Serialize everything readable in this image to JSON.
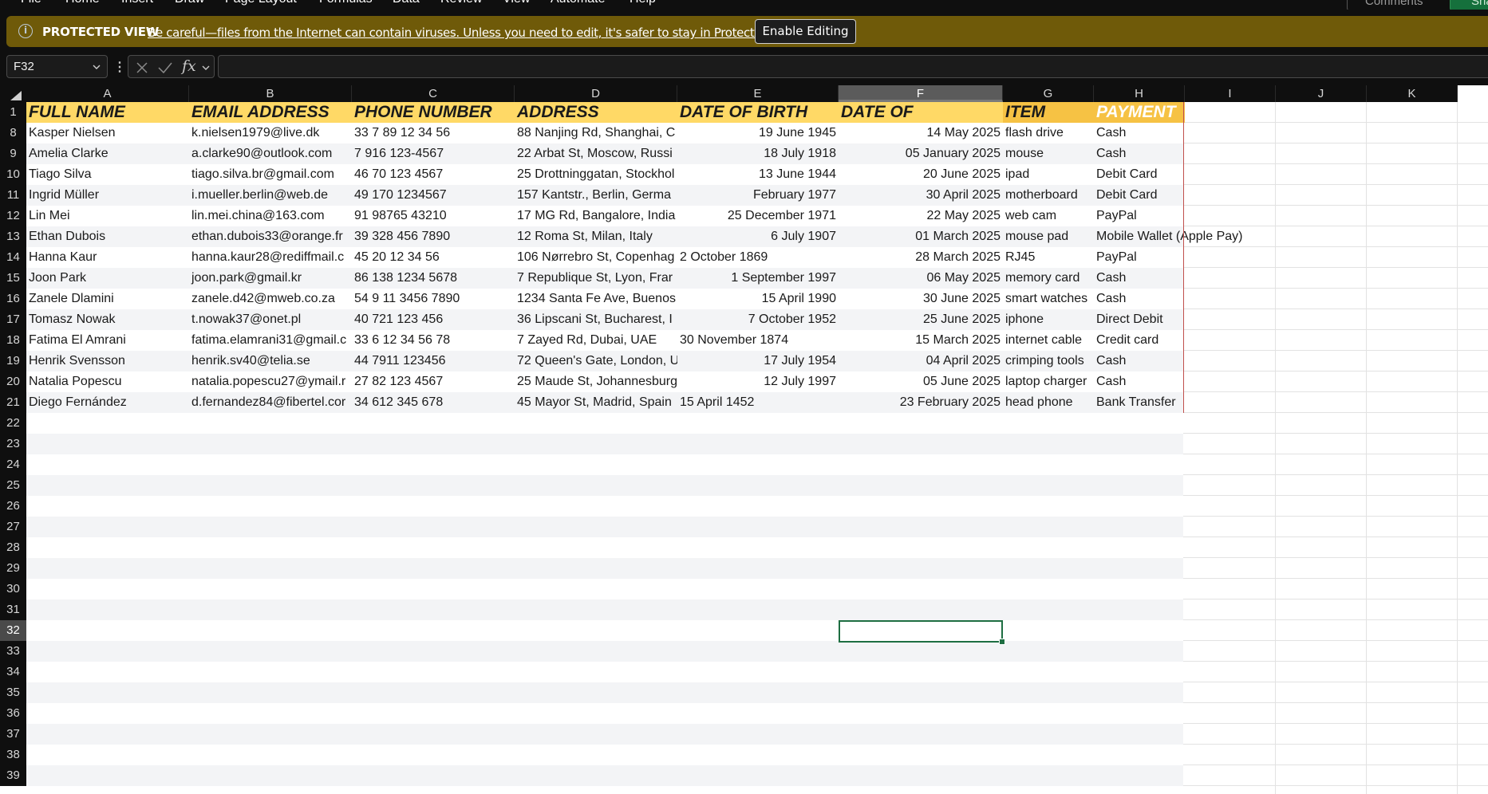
{
  "menu": {
    "items": [
      "File",
      "Home",
      "Insert",
      "Draw",
      "Page Layout",
      "Formulas",
      "Data",
      "Review",
      "View",
      "Automate",
      "Help"
    ],
    "comments_label": "Comments",
    "share_label": "Sha"
  },
  "protected_view": {
    "title": "PROTECTED VIEW",
    "message": "Be careful—files from the Internet can contain viruses. Unless you need to edit, it's safer to stay in Protected View.",
    "enable_button": "Enable Editing"
  },
  "formula_bar": {
    "name_box": "F32",
    "fx_label": "fx",
    "formula": ""
  },
  "grid": {
    "columns": [
      "A",
      "B",
      "C",
      "D",
      "E",
      "F",
      "G",
      "H",
      "I",
      "J",
      "K"
    ],
    "selected_column": "F",
    "selected_row": "32",
    "header_row_number": "1",
    "empty_rows": [
      "22",
      "23",
      "24",
      "25",
      "26",
      "27",
      "28",
      "29",
      "30",
      "31",
      "32",
      "33",
      "34",
      "35",
      "36",
      "37",
      "38",
      "39"
    ],
    "headers": [
      "FULL NAME",
      "EMAIL ADDRESS",
      "PHONE NUMBER",
      "ADDRESS",
      "DATE OF BIRTH",
      "DATE OF",
      "ITEM",
      "PAYMENT"
    ],
    "rows": [
      {
        "num": "8",
        "cells": [
          "Kasper Nielsen",
          "k.nielsen1979@live.dk",
          "33 7 89 12 34 56",
          "88 Nanjing Rd, Shanghai, C",
          "19 June 1945",
          "14 May 2025",
          "flash drive",
          "Cash"
        ]
      },
      {
        "num": "9",
        "cells": [
          "Amelia Clarke",
          "a.clarke90@outlook.com",
          "7 916 123-4567",
          "22 Arbat St, Moscow, Russi",
          "18 July 1918",
          "05 January 2025",
          "mouse",
          "Cash"
        ]
      },
      {
        "num": "10",
        "cells": [
          "Tiago Silva",
          "tiago.silva.br@gmail.com",
          "46 70 123 4567",
          "25 Drottninggatan, Stockhol",
          "13 June 1944",
          "20 June 2025",
          "ipad",
          "Debit Card"
        ]
      },
      {
        "num": "11",
        "cells": [
          "Ingrid Müller",
          "i.mueller.berlin@web.de",
          "49 170 1234567",
          "157 Kantstr., Berlin, Germa",
          "February 1977",
          "30 April 2025",
          "motherboard",
          "Debit Card"
        ]
      },
      {
        "num": "12",
        "cells": [
          "Lin Mei",
          "lin.mei.china@163.com",
          "91 98765 43210",
          "17 MG Rd, Bangalore, India",
          "25 December 1971",
          "22 May 2025",
          "web cam",
          "PayPal"
        ]
      },
      {
        "num": "13",
        "cells": [
          "Ethan Dubois",
          "ethan.dubois33@orange.fr",
          "39 328 456 7890",
          "12 Roma St, Milan, Italy",
          "6 July 1907",
          "01 March 2025",
          "mouse pad",
          "Mobile Wallet (Apple Pay)"
        ]
      },
      {
        "num": "14",
        "cells": [
          "Hanna Kaur",
          "hanna.kaur28@rediffmail.c",
          "45 20 12 34 56",
          "106 Nørrebro St, Copenhag",
          "2 October 1869",
          "28 March 2025",
          "RJ45",
          "PayPal"
        ]
      },
      {
        "num": "15",
        "cells": [
          "Joon Park",
          "joon.park@gmail.kr",
          "86 138 1234 5678",
          "7 Republique St, Lyon, Frar",
          "1 September 1997",
          "06 May 2025",
          "memory card",
          "Cash"
        ]
      },
      {
        "num": "16",
        "cells": [
          "Zanele Dlamini",
          "zanele.d42@mweb.co.za",
          "54 9 11 3456 7890",
          "1234 Santa Fe Ave, Buenos",
          "15 April 1990",
          "30 June 2025",
          "smart watches",
          "Cash"
        ]
      },
      {
        "num": "17",
        "cells": [
          "Tomasz Nowak",
          "t.nowak37@onet.pl",
          "40 721 123 456",
          "36 Lipscani St, Bucharest, I",
          "7 October 1952",
          "25 June 2025",
          "iphone",
          "Direct Debit"
        ]
      },
      {
        "num": "18",
        "cells": [
          "Fatima El Amrani",
          "fatima.elamrani31@gmail.c",
          "33 6 12 34 56 78",
          "7 Zayed Rd, Dubai, UAE",
          "30 November 1874",
          "15 March 2025",
          "internet cable",
          "Credit card"
        ]
      },
      {
        "num": "19",
        "cells": [
          "Henrik Svensson",
          "henrik.sv40@telia.se",
          "44 7911 123456",
          "72 Queen's Gate, London, U",
          "17 July 1954",
          "04 April 2025",
          "crimping tools",
          "Cash"
        ]
      },
      {
        "num": "20",
        "cells": [
          "Natalia Popescu",
          "natalia.popescu27@ymail.r",
          "27 82 123 4567",
          "25 Maude St, Johannesburg",
          "12 July 1997",
          "05 June 2025",
          "laptop charger",
          "Cash"
        ]
      },
      {
        "num": "21",
        "cells": [
          "Diego Fernández",
          "d.fernandez84@fibertel.cor",
          "34 612 345 678",
          "45 Mayor St, Madrid, Spain",
          "15 April 1452",
          "23 February 2025",
          "head phone",
          "Bank Transfer"
        ]
      }
    ],
    "dob_left_aligned_rows": [
      "14",
      "18",
      "21"
    ]
  },
  "colors": {
    "header_fill_light": "#ffd966",
    "header_fill_dark": "#f6c244",
    "payment_header_text": "#ffffff",
    "protected_bar": "#6f5a09",
    "selection_border": "#1e6e42",
    "table_edge": "#c0504d"
  },
  "icons": [
    "info-icon",
    "chevron-down-icon",
    "cancel-x-icon",
    "enter-check-icon",
    "select-all-triangle-icon",
    "comment-icon"
  ]
}
